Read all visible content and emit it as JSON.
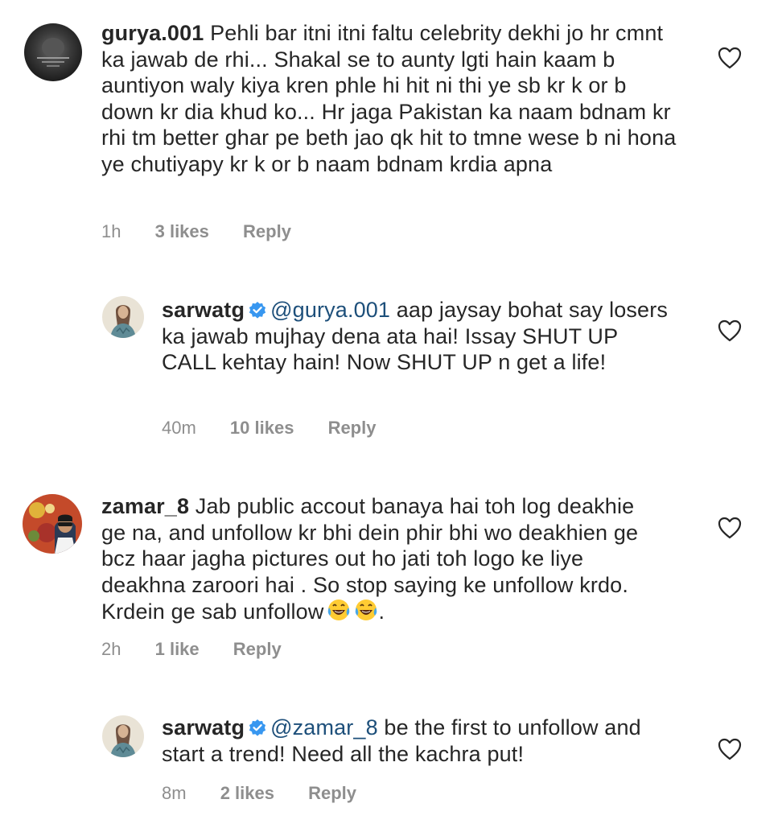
{
  "comments": [
    {
      "username": "gurya.001",
      "text": "Pehli bar itni itni faltu celebrity dekhi jo hr cmnt ka jawab de rhi... Shakal se to aunty lgti hain kaam b auntiyon waly kiya kren phle hi hit ni thi ye sb kr k or b down kr dia khud ko... Hr jaga Pakistan ka naam bdnam kr rhi tm better ghar pe beth jao qk hit to tmne wese b ni hona ye chutiyapy kr k or b naam bdnam krdia apna",
      "time": "1h",
      "likes": "3 likes",
      "reply": "Reply"
    },
    {
      "username": "sarwatg",
      "mention": "@gurya.001",
      "text": "aap jaysay bohat say losers ka jawab mujhay dena ata hai! Issay SHUT UP CALL kehtay hain! Now SHUT UP n get a life!",
      "time": "40m",
      "likes": "10 likes",
      "reply": "Reply"
    },
    {
      "username": "zamar_8",
      "text": "Jab public accout banaya hai toh log deakhie ge na, and unfollow kr bhi dein phir bhi wo deakhien ge bcz haar jagha pictures out ho jati toh logo ke liye deakhna zaroori hai . So stop saying ke unfollow krdo. Krdein ge sab unfollow",
      "text_end": ".",
      "time": "2h",
      "likes": "1 like",
      "reply": "Reply"
    },
    {
      "username": "sarwatg",
      "mention": "@zamar_8",
      "text": "be the first to unfollow and start a trend! Need all the kachra put!",
      "time": "8m",
      "likes": "2 likes",
      "reply": "Reply"
    }
  ],
  "icons": {
    "heart": "heart-outline-icon",
    "verified": "verified-badge-icon",
    "emoji": "laughing-tears-emoji"
  },
  "colors": {
    "text": "#262626",
    "meta": "#8e8e8e",
    "mention": "#1d4f7a",
    "verified": "#3897f0"
  }
}
